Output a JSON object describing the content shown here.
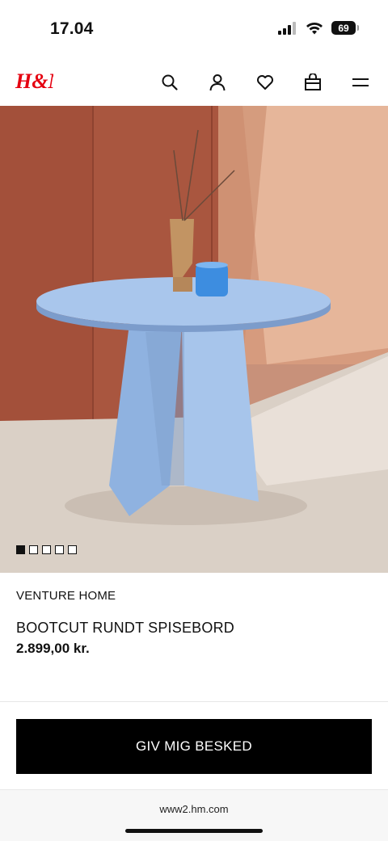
{
  "status": {
    "time": "17.04",
    "battery": "69"
  },
  "header": {
    "logo_text": "H&M",
    "brand_color": "#e50010",
    "icons": [
      "search-icon",
      "account-icon",
      "heart-icon",
      "bag-icon",
      "menu-icon"
    ]
  },
  "carousel": {
    "total_images": 5,
    "active_index": 0
  },
  "product": {
    "brand": "VENTURE HOME",
    "name": "BOOTCUT RUNDT SPISEBORD",
    "price": "2.899,00 kr."
  },
  "action": {
    "button_label": "GIV MIG BESKED"
  },
  "browser": {
    "url": "www2.hm.com"
  }
}
